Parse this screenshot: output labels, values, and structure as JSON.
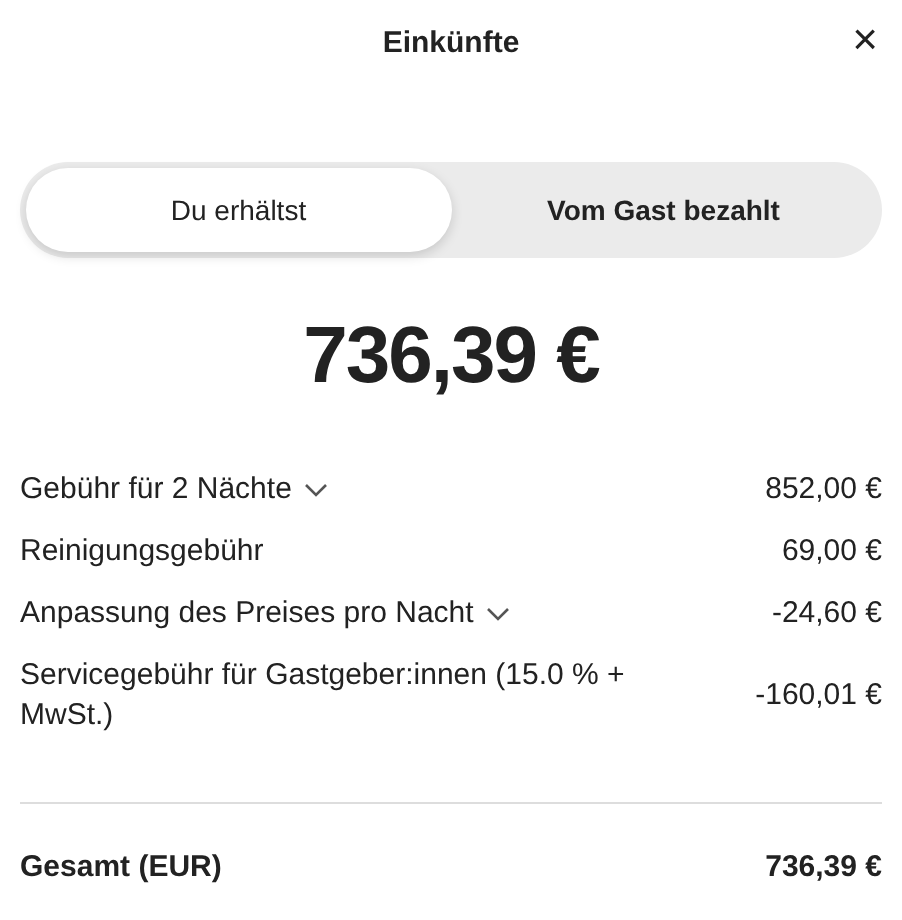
{
  "header": {
    "title": "Einkünfte",
    "close": "×"
  },
  "tabs": [
    {
      "label": "Du erhältst",
      "selected": true
    },
    {
      "label": "Vom Gast bezahlt",
      "selected": false
    }
  ],
  "amount": "736,39 €",
  "line_items": [
    {
      "label": "Gebühr für 2 Nächte",
      "expandable": true,
      "value": "852,00 €"
    },
    {
      "label": "Reinigungsgebühr",
      "expandable": false,
      "value": "69,00 €"
    },
    {
      "label": "Anpassung des Preises pro Nacht",
      "expandable": true,
      "value": "-24,60 €"
    },
    {
      "label": "Servicegebühr für Gastgeber:innen (15.0 % + MwSt.)",
      "expandable": false,
      "value": "-160,01 €"
    }
  ],
  "total": {
    "label": "Gesamt (EUR)",
    "value": "736,39 €"
  }
}
